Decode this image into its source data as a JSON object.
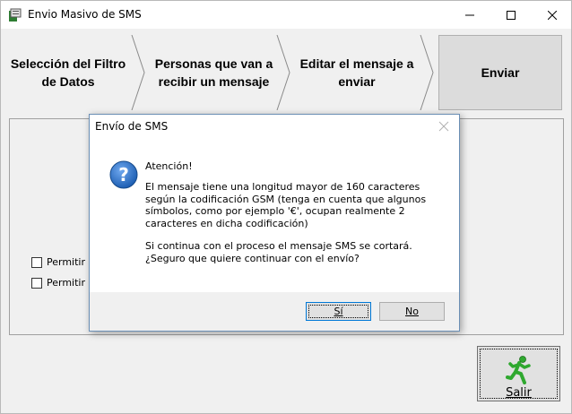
{
  "window": {
    "title": "Envio Masivo de SMS",
    "minimize_icon": "minimize-icon",
    "maximize_icon": "maximize-icon",
    "close_icon": "close-icon"
  },
  "steps": [
    {
      "label_line1": "Selección del Filtro",
      "label_line2": "de Datos"
    },
    {
      "label_line1": "Personas que van a",
      "label_line2": "recibir un mensaje"
    },
    {
      "label_line1": "Editar el mensaje a",
      "label_line2": "enviar"
    },
    {
      "label_line1": "Enviar",
      "label_line2": ""
    }
  ],
  "panel": {
    "checkbox1_label": "Permitir en",
    "checkbox2_label": "Permitir en"
  },
  "exit_button": {
    "label": "Salir",
    "icon": "running-man-icon"
  },
  "dialog": {
    "title": "Envío de SMS",
    "icon": "question-icon",
    "heading": "Atención!",
    "message1": "El mensaje tiene una longitud mayor de 160 caracteres según la codificación GSM (tenga en cuenta que algunos símbolos, como por ejemplo '€', ocupan realmente 2 caracteres en dicha codificación)",
    "message2": "Si continua con el proceso el mensaje SMS se cortará. ¿Seguro que quiere continuar con el envío?",
    "yes_label": "Sí",
    "no_label": "No"
  },
  "colors": {
    "accent": "#0078d7",
    "active_step_bg": "#dcdcdc",
    "question_icon": "#1e5fb3"
  }
}
